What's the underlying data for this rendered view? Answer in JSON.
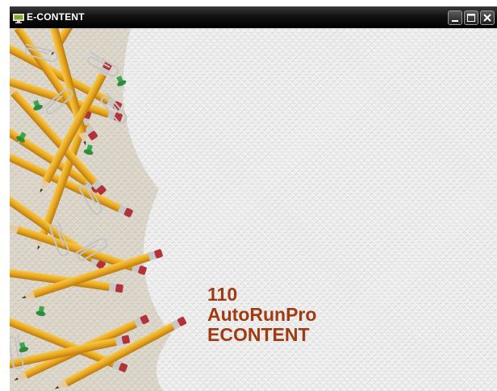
{
  "window": {
    "title": "E-CONTENT",
    "icons": {
      "app": "monitor-icon",
      "minimize": "minimize-icon",
      "maximize": "maximize-icon",
      "close": "close-icon"
    }
  },
  "content": {
    "lines": [
      "110",
      "AutoRunPro",
      "ECONTENT"
    ]
  },
  "colors": {
    "caption": "#a03a10",
    "titlebar": "#000000",
    "background": "#eeeeee"
  }
}
